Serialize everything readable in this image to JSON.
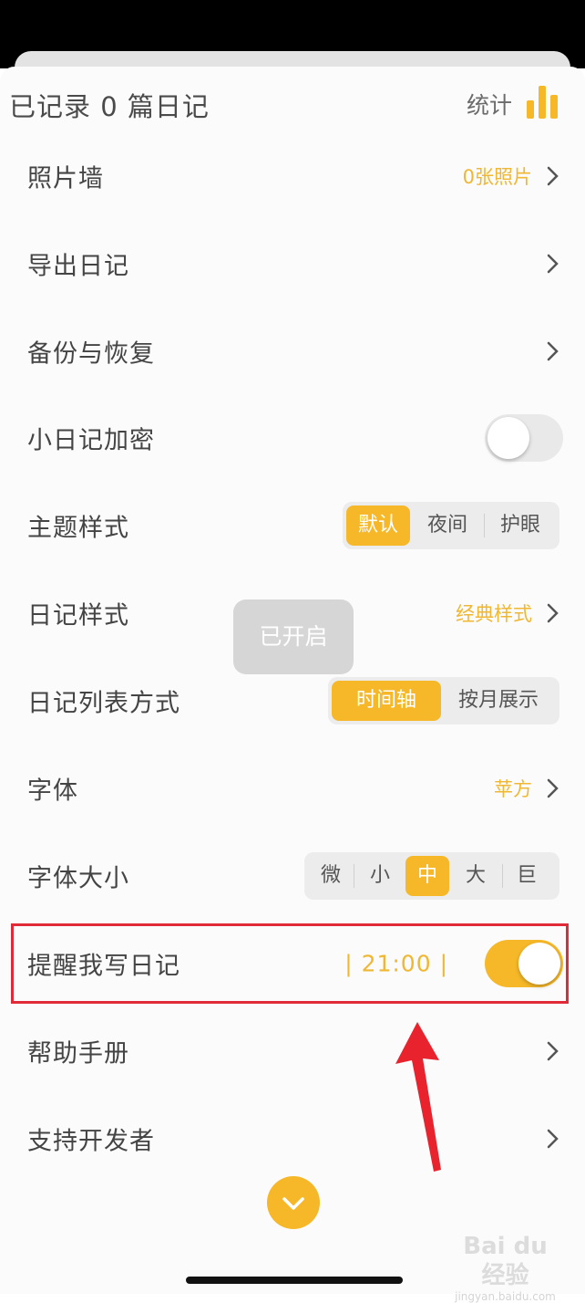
{
  "header": {
    "title": "已记录 0 篇日记",
    "stats_label": "统计",
    "stats_icon": "bar-chart-icon"
  },
  "rows": {
    "photo_wall": {
      "label": "照片墙",
      "value": "0张照片"
    },
    "export": {
      "label": "导出日记"
    },
    "backup": {
      "label": "备份与恢复"
    },
    "lock": {
      "label": "小日记加密",
      "toggle": "off"
    },
    "theme": {
      "label": "主题样式",
      "options": [
        "默认",
        "夜间",
        "护眼"
      ],
      "selected": "默认"
    },
    "diary_style": {
      "label": "日记样式",
      "value": "经典样式"
    },
    "list_mode": {
      "label": "日记列表方式",
      "options": [
        "时间轴",
        "按月展示"
      ],
      "selected": "时间轴"
    },
    "font": {
      "label": "字体",
      "value": "苹方"
    },
    "font_size": {
      "label": "字体大小",
      "options": [
        "微",
        "小",
        "中",
        "大",
        "巨"
      ],
      "selected": "中"
    },
    "reminder": {
      "label": "提醒我写日记",
      "time": "| 21:00 |",
      "toggle": "on"
    },
    "help": {
      "label": "帮助手册"
    },
    "support": {
      "label": "支持开发者"
    }
  },
  "toast": {
    "text": "已开启"
  },
  "fab_icon": "chevron-down-icon",
  "watermark": {
    "brand": "Bai du 经验",
    "url": "jingyan.baidu.com"
  },
  "colors": {
    "accent": "#f6b828",
    "highlight": "#e02a37"
  }
}
